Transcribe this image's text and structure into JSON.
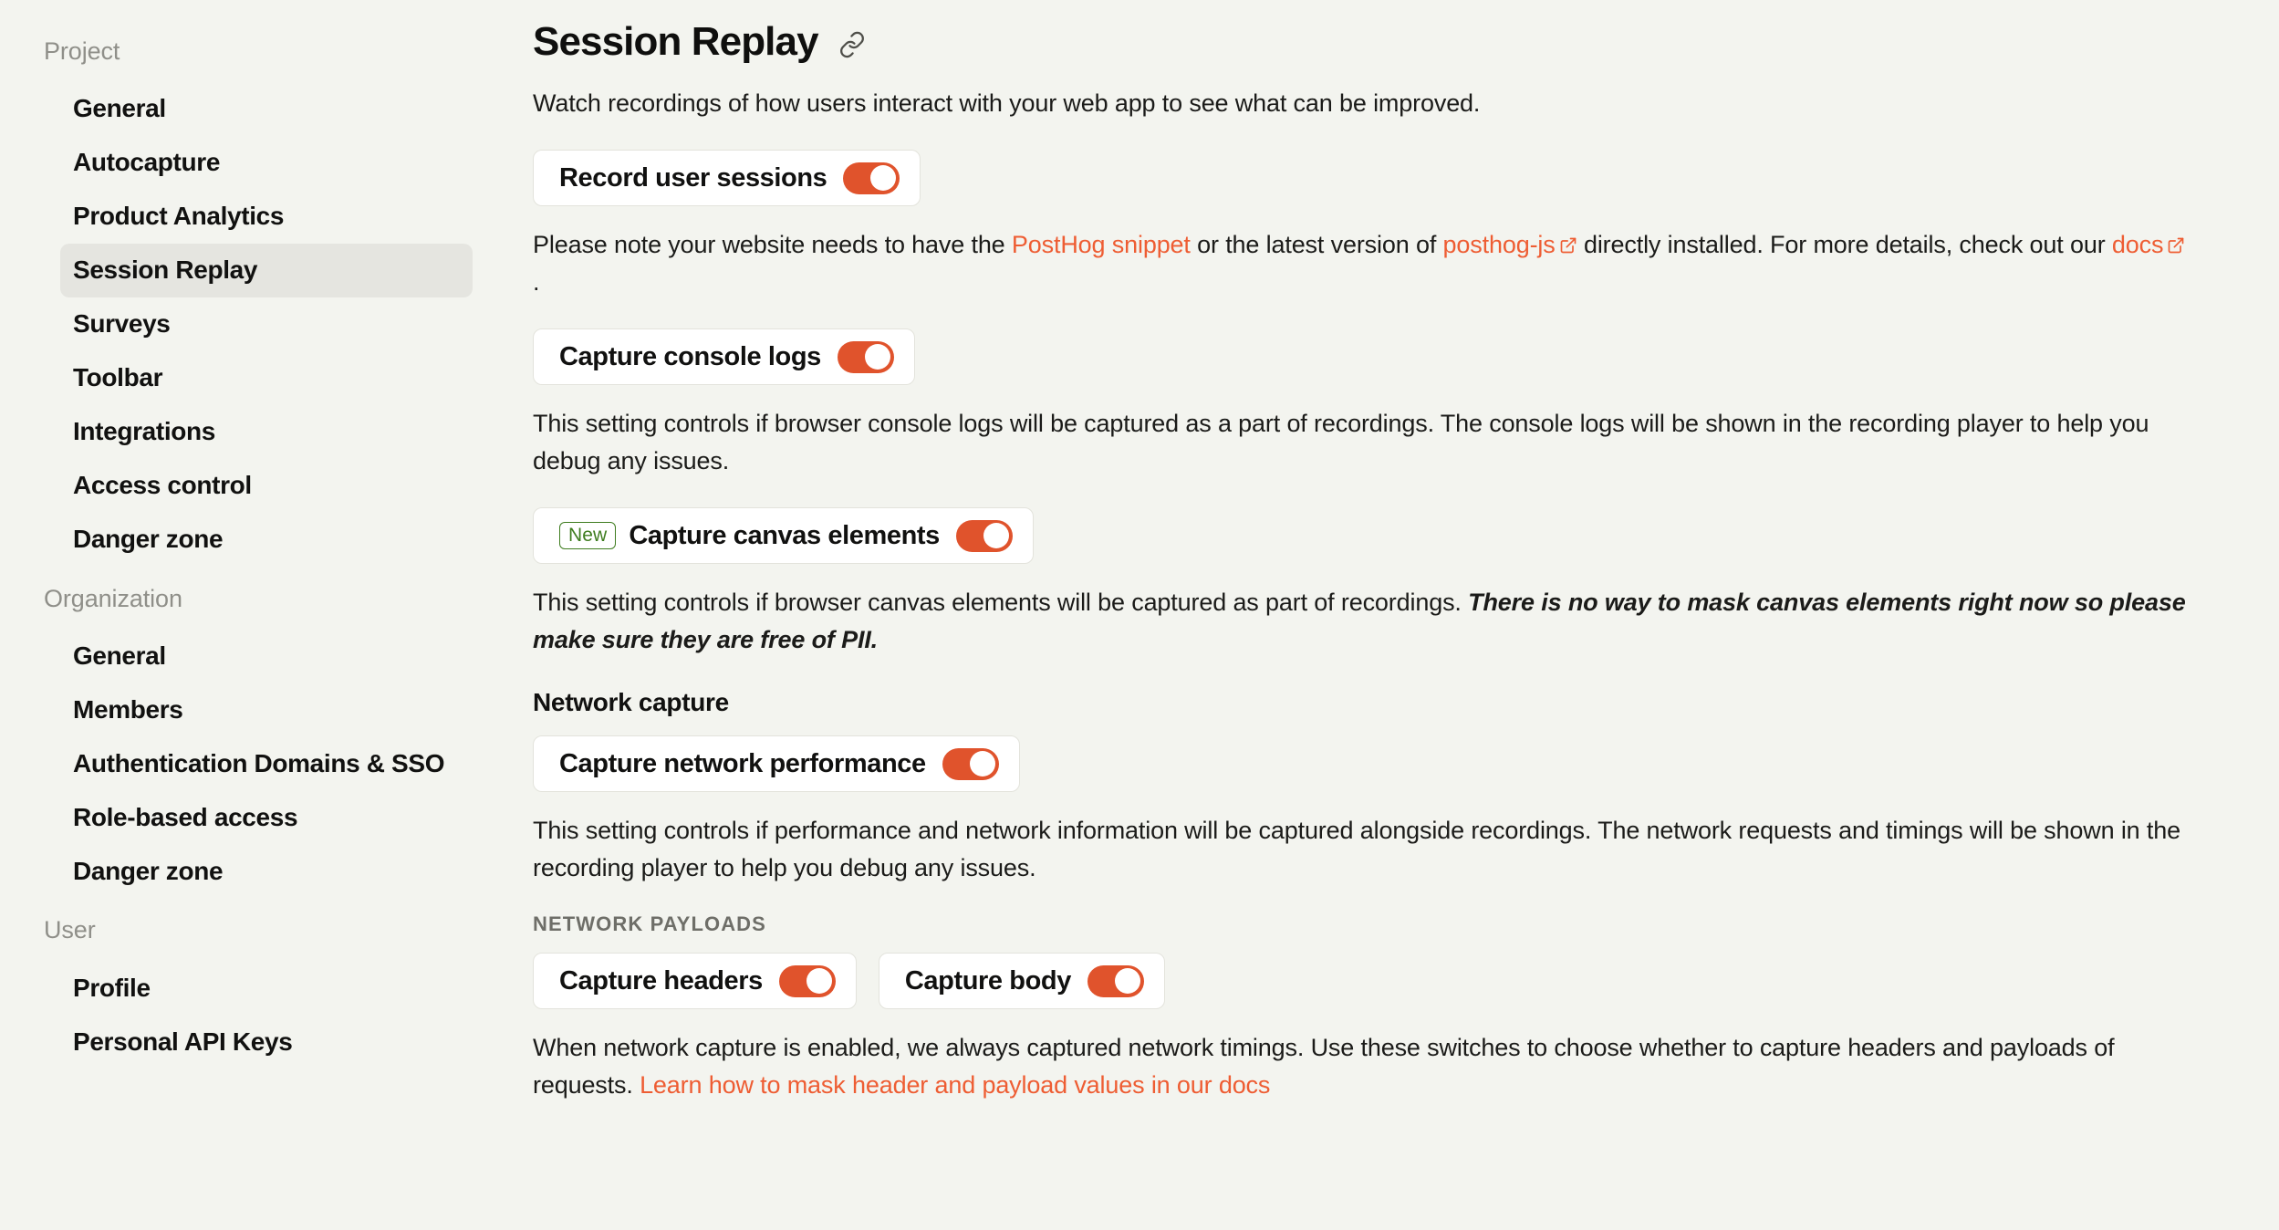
{
  "colors": {
    "page_background": "#f3f4ef",
    "accent_orange": "#e0532c",
    "link_orange": "#ee5d33",
    "badge_green": "#3f7d20",
    "card_background": "#ffffff",
    "sidebar_active": "#e5e5e0"
  },
  "sidebar": {
    "groups": [
      {
        "label": "Project",
        "items": [
          {
            "label": "General",
            "active": false
          },
          {
            "label": "Autocapture",
            "active": false
          },
          {
            "label": "Product Analytics",
            "active": false
          },
          {
            "label": "Session Replay",
            "active": true
          },
          {
            "label": "Surveys",
            "active": false
          },
          {
            "label": "Toolbar",
            "active": false
          },
          {
            "label": "Integrations",
            "active": false
          },
          {
            "label": "Access control",
            "active": false
          },
          {
            "label": "Danger zone",
            "active": false
          }
        ]
      },
      {
        "label": "Organization",
        "items": [
          {
            "label": "General",
            "active": false
          },
          {
            "label": "Members",
            "active": false
          },
          {
            "label": "Authentication Domains & SSO",
            "active": false
          },
          {
            "label": "Role-based access",
            "active": false
          },
          {
            "label": "Danger zone",
            "active": false
          }
        ]
      },
      {
        "label": "User",
        "items": [
          {
            "label": "Profile",
            "active": false
          },
          {
            "label": "Personal API Keys",
            "active": false
          }
        ]
      }
    ]
  },
  "header": {
    "title": "Session Replay",
    "link_icon": "link-icon"
  },
  "main": {
    "lede": "Watch recordings of how users interact with your web app to see what can be improved.",
    "record_sessions": {
      "label": "Record user sessions",
      "toggle_on": true
    },
    "snippet_note": {
      "part1": "Please note your website needs to have the ",
      "link1": "PostHog snippet",
      "part2": " or the latest version of ",
      "link2": "posthog-js",
      "part3": " directly installed. For more details, check out our ",
      "link3": "docs",
      "part4": "."
    },
    "console_logs": {
      "label": "Capture console logs",
      "toggle_on": true,
      "description": "This setting controls if browser console logs will be captured as a part of recordings. The console logs will be shown in the recording player to help you debug any issues."
    },
    "canvas": {
      "badge": "New",
      "label": "Capture canvas elements",
      "toggle_on": true,
      "description_normal": "This setting controls if browser canvas elements will be captured as part of recordings. ",
      "description_emphasis": "There is no way to mask canvas elements right now so please make sure they are free of PII."
    },
    "network_capture": {
      "section_title": "Network capture",
      "performance": {
        "label": "Capture network performance",
        "toggle_on": true
      },
      "description": "This setting controls if performance and network information will be captured alongside recordings. The network requests and timings will be shown in the recording player to help you debug any issues.",
      "payloads_title": "NETWORK PAYLOADS",
      "headers": {
        "label": "Capture headers",
        "toggle_on": true
      },
      "body": {
        "label": "Capture body",
        "toggle_on": true
      },
      "payload_note_part1": "When network capture is enabled, we always captured network timings. Use these switches to choose whether to capture headers and payloads of requests. ",
      "payload_note_link": "Learn how to mask header and payload values in our docs"
    }
  }
}
